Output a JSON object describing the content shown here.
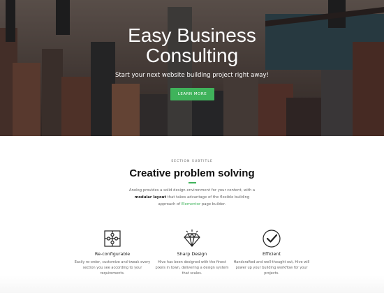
{
  "hero": {
    "title_line1": "Easy Business",
    "title_line2": "Consulting",
    "subtitle": "Start your next website building project right away!",
    "button_label": "LEARN MORE"
  },
  "section": {
    "subtitle": "SECTION SUBTITLE",
    "title": "Creative problem solving",
    "desc_part1": "Anolog provides a solid design environment for your content, with a",
    "desc_bold": "modular layout",
    "desc_part2": "that takes advantage of the flexible building approach of",
    "desc_link": "Elementor",
    "desc_part3": "page builder."
  },
  "features": [
    {
      "icon": "puzzle-icon",
      "title": "Re-configurable",
      "desc": "Easily re-order, customize and tweak every section you see according to your requirements."
    },
    {
      "icon": "diamond-icon",
      "title": "Sharp Design",
      "desc": "Hive has been designed with the finest pixels in town, delivering a design system that scales."
    },
    {
      "icon": "checkmark-circle-icon",
      "title": "Efficient",
      "desc": "Handcrafted and well-thought out, Hive will power up your building workflow for your projects."
    }
  ],
  "colors": {
    "accent": "#3fb35b",
    "hero_overlay": "#1a1a1a"
  }
}
